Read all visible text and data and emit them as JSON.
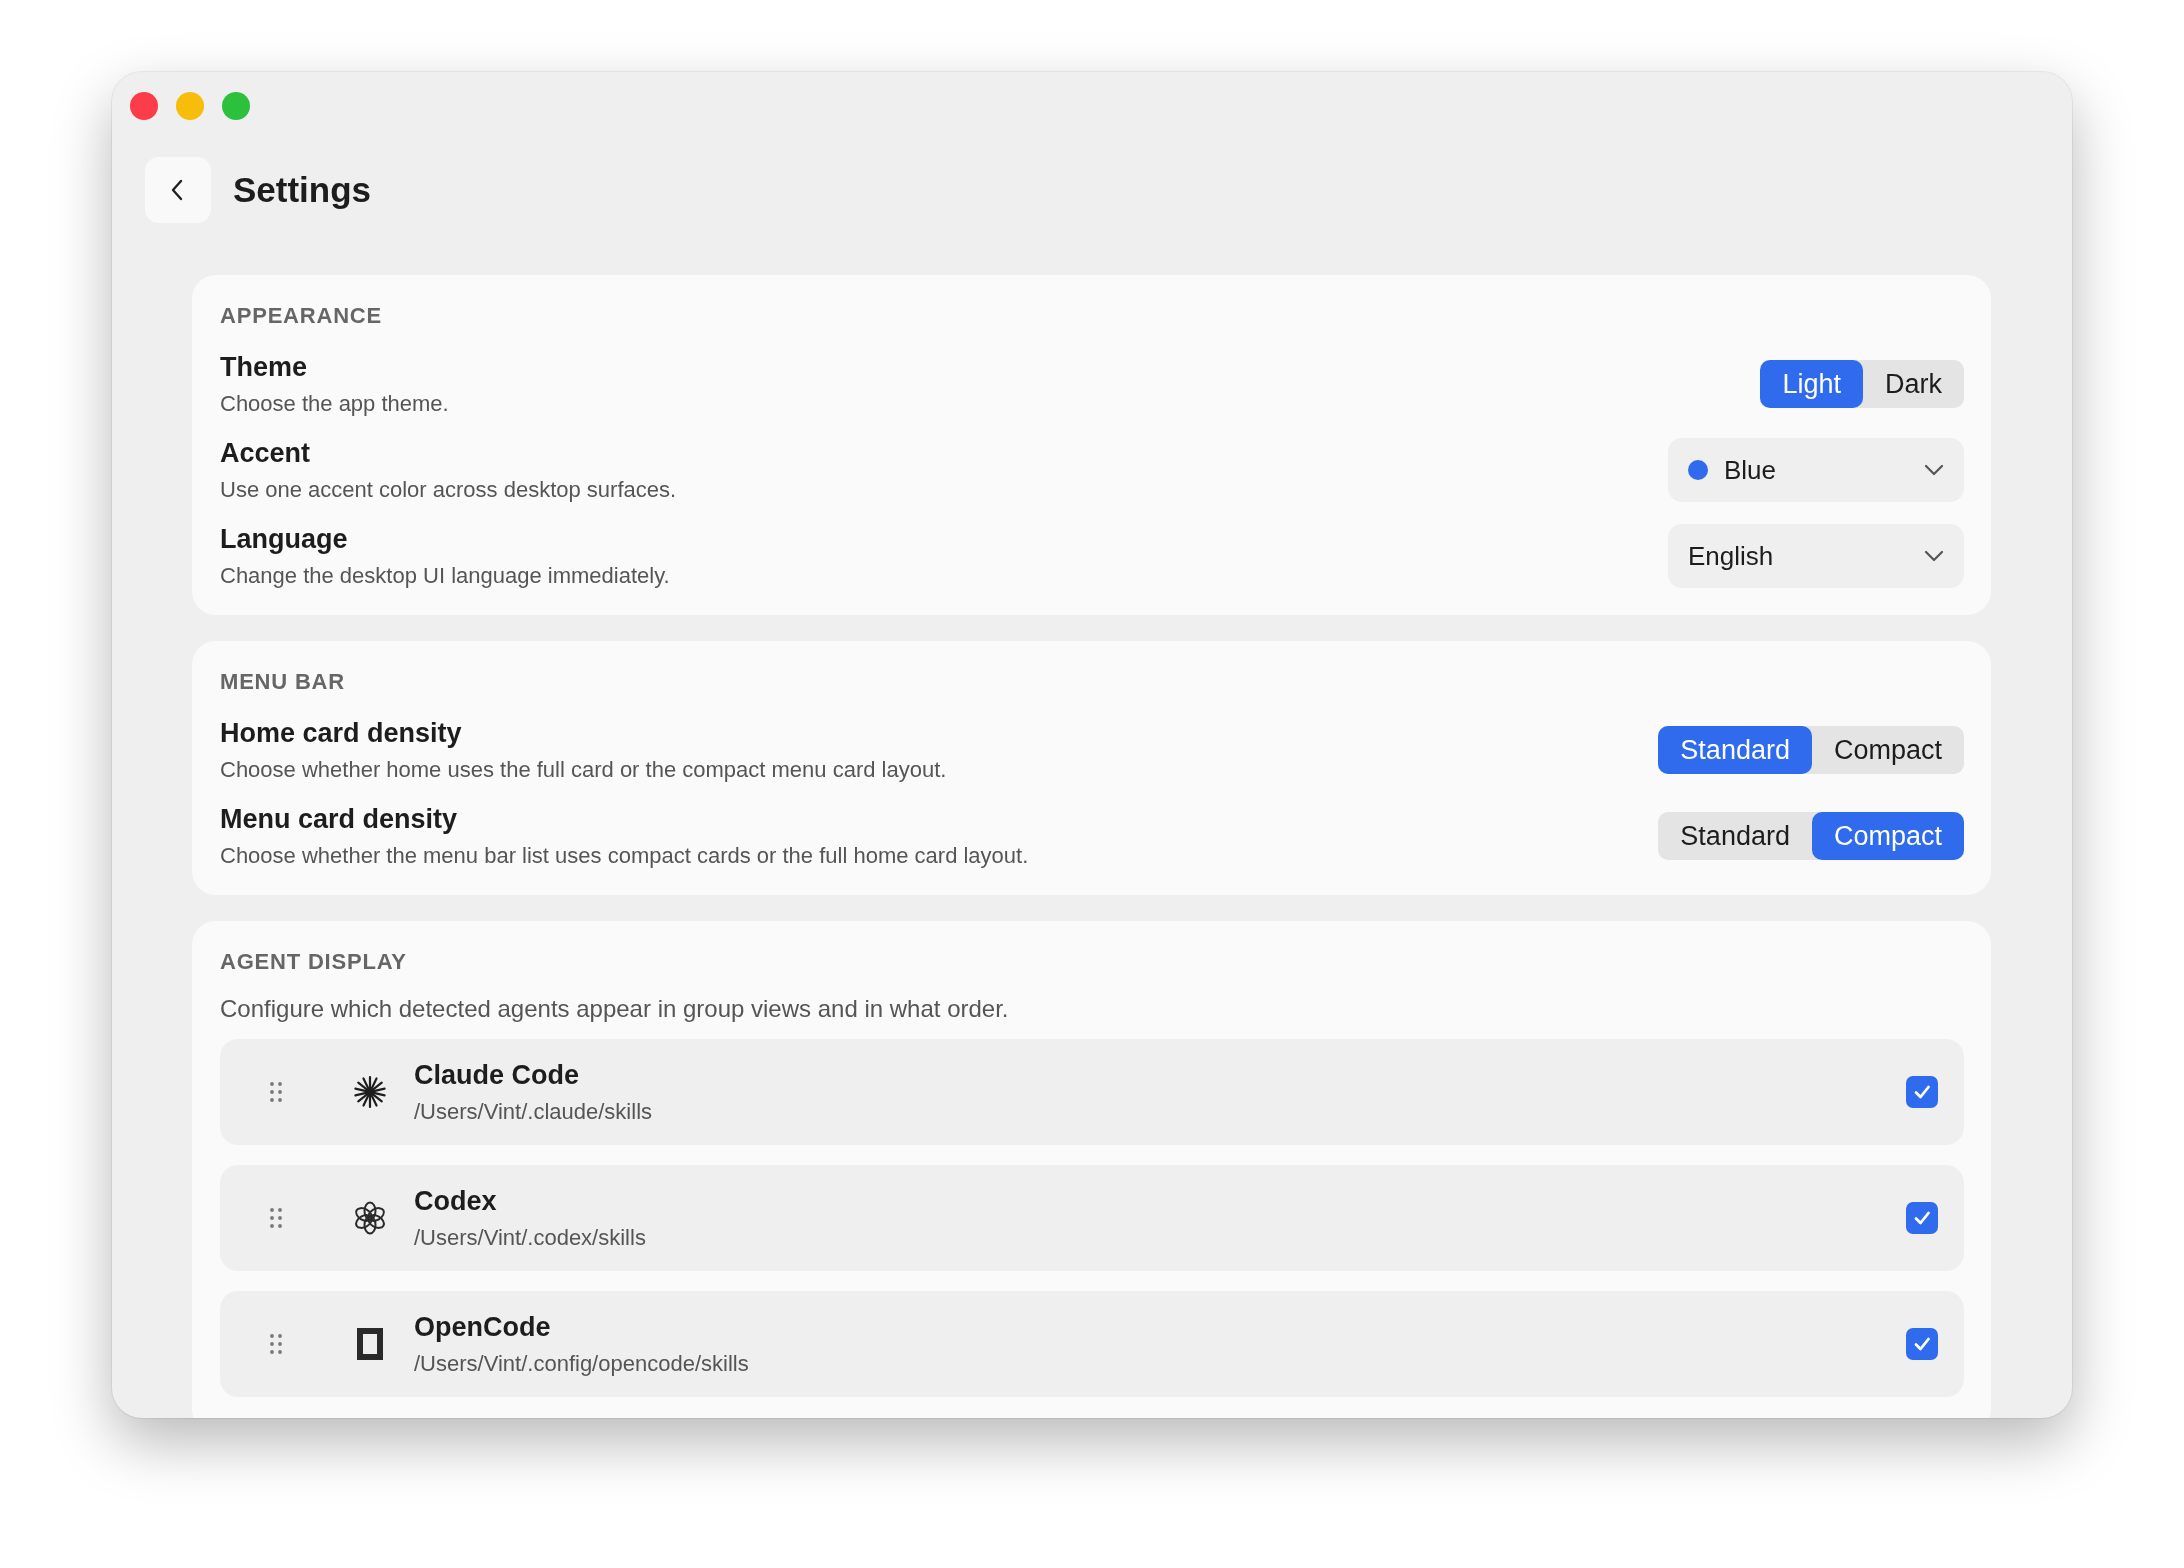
{
  "window": {
    "title": "Settings"
  },
  "sections": [
    {
      "title": "APPEARANCE",
      "rows": [
        {
          "kind": "segmented",
          "label": "Theme",
          "description": "Choose the app theme.",
          "options": [
            {
              "label": "Light",
              "selected": true
            },
            {
              "label": "Dark",
              "selected": false
            }
          ]
        },
        {
          "kind": "dropdown",
          "label": "Accent",
          "description": "Use one accent color across desktop surfaces.",
          "value": "Blue",
          "color": "#2f6bec"
        },
        {
          "kind": "dropdown",
          "label": "Language",
          "description": "Change the desktop UI language immediately.",
          "value": "English"
        }
      ]
    },
    {
      "title": "MENU BAR",
      "rows": [
        {
          "kind": "segmented",
          "label": "Home card density",
          "description": "Choose whether home uses the full card or the compact menu card layout.",
          "options": [
            {
              "label": "Standard",
              "selected": true
            },
            {
              "label": "Compact",
              "selected": false
            }
          ]
        },
        {
          "kind": "segmented",
          "label": "Menu card density",
          "description": "Choose whether the menu bar list uses compact cards or the full home card layout.",
          "options": [
            {
              "label": "Standard",
              "selected": false
            },
            {
              "label": "Compact",
              "selected": true
            }
          ]
        }
      ]
    },
    {
      "title": "AGENT DISPLAY",
      "description": "Configure which detected agents appear in group views and in what order.",
      "agents": [
        {
          "kind": "asterisk",
          "name": "Claude Code",
          "path": "/Users/Vint/.claude/skills",
          "checked": true
        },
        {
          "kind": "knot",
          "name": "Codex",
          "path": "/Users/Vint/.codex/skills",
          "checked": true
        },
        {
          "kind": "frame",
          "name": "OpenCode",
          "path": "/Users/Vint/.config/opencode/skills",
          "checked": true
        }
      ]
    }
  ]
}
